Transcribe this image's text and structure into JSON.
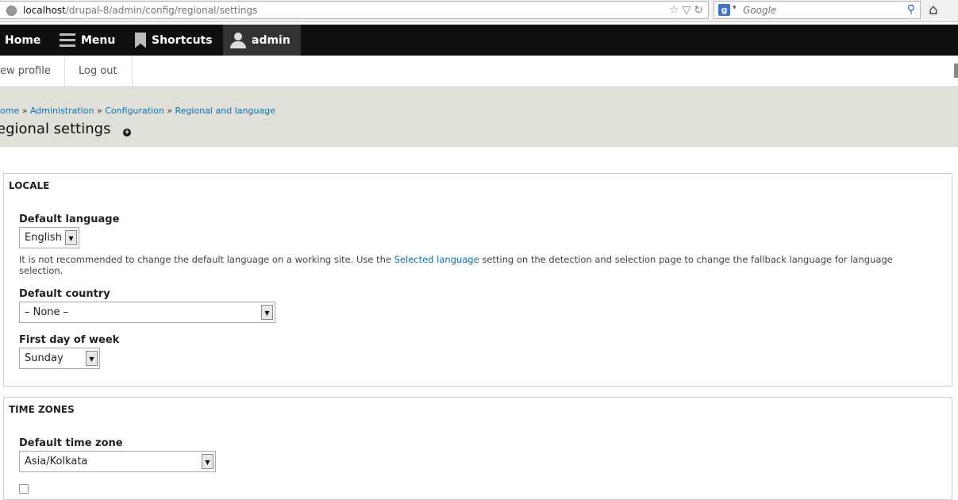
{
  "browser": {
    "url_host": "localhost",
    "url_path": "/drupal-8/admin/config/regional/settings",
    "search_placeholder": "Google",
    "search_engine_letter": "g"
  },
  "toolbar": {
    "home": "Home",
    "menu": "Menu",
    "shortcuts": "Shortcuts",
    "user": "admin"
  },
  "tray": {
    "view_profile": "ew profile",
    "log_out": "Log out"
  },
  "breadcrumb": {
    "home": "ome",
    "sep": "»",
    "administration": "Administration",
    "configuration": "Configuration",
    "regional": "Regional and language"
  },
  "page": {
    "title": "egional settings"
  },
  "locale": {
    "legend": "LOCALE",
    "default_language_label": "Default language",
    "default_language_value": "English",
    "help_before": "It is not recommended to change the default language on a working site. Use the ",
    "help_link": "Selected language",
    "help_after": " setting on the detection and selection page to change the fallback language for language selection.",
    "default_country_label": "Default country",
    "default_country_value": "– None –",
    "first_day_label": "First day of week",
    "first_day_value": "Sunday"
  },
  "timezones": {
    "legend": "TIME ZONES",
    "default_tz_label": "Default time zone",
    "default_tz_value": "Asia/Kolkata"
  }
}
